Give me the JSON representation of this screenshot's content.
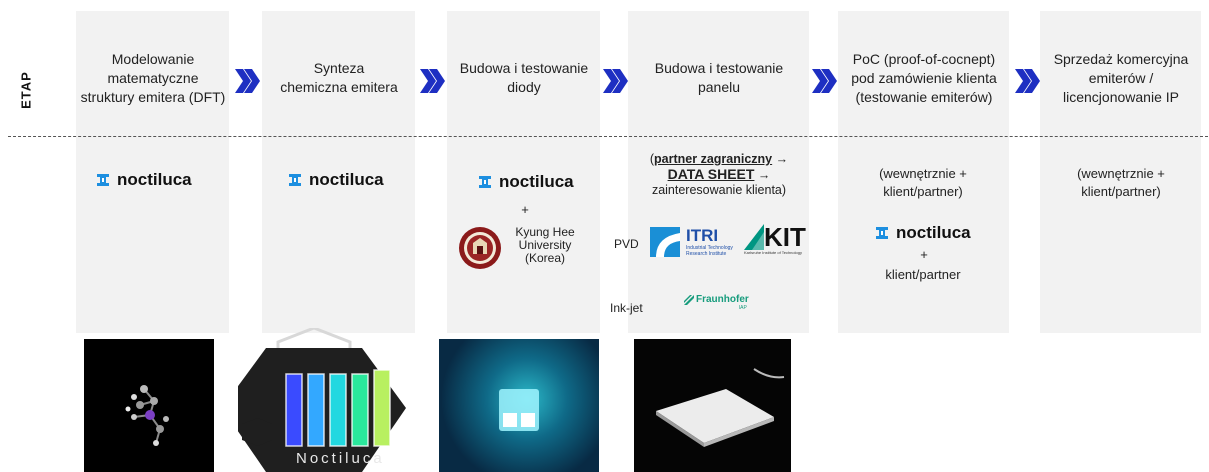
{
  "row_label": "ETAP",
  "stages": [
    {
      "title": "Modelowanie matematyczne struktury emitera (DFT)"
    },
    {
      "title": "Synteza chemiczna emitera"
    },
    {
      "title": "Budowa i testowanie diody"
    },
    {
      "title": "Budowa i testowanie panelu"
    },
    {
      "title": "PoC (proof-of-cocnept) pod zamówienie klienta (testowanie emiterów)"
    },
    {
      "title": "Sprzedaż komercyjna emiterów / licencjonowanie IP"
    }
  ],
  "brand": {
    "logo_text": "noctiluca",
    "accent": "#1d8fe0"
  },
  "col3": {
    "plus": "+",
    "university": "Kyung Hee University (Korea)"
  },
  "col4": {
    "paren_open": "(",
    "partner": "partner zagraniczny",
    "arrow1": "→",
    "datasheet": "DATA SHEET",
    "arrow2": "→",
    "interest": "zainteresowanie klienta)",
    "pvd_label": "PVD",
    "itri_name": "ITRI",
    "itri_sub": "Industrial Technology Research Institute",
    "kit_name": "KIT",
    "kit_sub": "Karlsruhe Institute of Technology",
    "inkjet_label": "Ink-jet",
    "fraunhofer_name": "Fraunhofer",
    "fraunhofer_sub": "IAP"
  },
  "col5": {
    "top": "(wewnętrznie + klient/partner)",
    "plus": "+",
    "bottom": "klient/partner"
  },
  "col6": {
    "top": "(wewnętrznie + klient/partner)"
  },
  "photo_caption": "Noctiluca"
}
